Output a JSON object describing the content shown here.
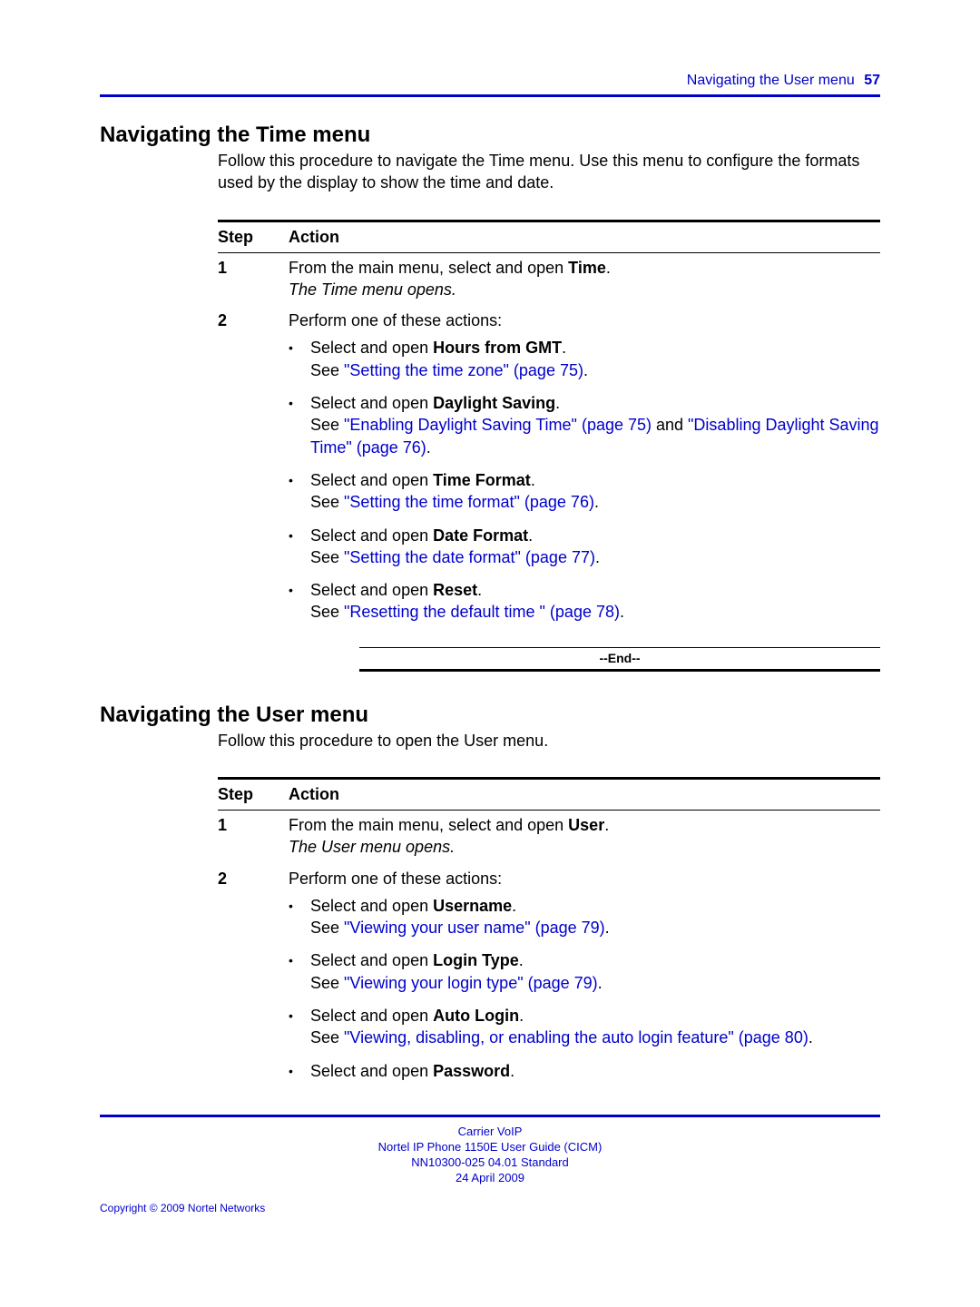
{
  "header": {
    "title": "Navigating the User menu",
    "page": "57"
  },
  "section1": {
    "heading": "Navigating the Time menu",
    "intro": "Follow this procedure to navigate the Time menu. Use this menu to configure the formats used by the display to show the time and date.",
    "step_label": "Step",
    "action_label": "Action",
    "step1_num": "1",
    "step1_a": "From the main menu, select and open ",
    "step1_bold": "Time",
    "step1_b": ".",
    "step1_note": "The Time menu opens.",
    "step2_num": "2",
    "step2_text": "Perform one of these actions:",
    "b1_a": "Select and open ",
    "b1_bold": "Hours from GMT",
    "b1_b": ".",
    "b1_see": "See ",
    "b1_link": "\"Setting the time zone\" (page 75)",
    "b1_end": ".",
    "b2_a": "Select and open ",
    "b2_bold": "Daylight Saving",
    "b2_b": ".",
    "b2_see": "See ",
    "b2_link1": "\"Enabling Daylight Saving Time\" (page 75)",
    "b2_mid": " and ",
    "b2_link2": "\"Disabling Daylight Saving Time\" (page 76)",
    "b2_end": ".",
    "b3_a": "Select and open ",
    "b3_bold": "Time Format",
    "b3_b": ".",
    "b3_see": "See ",
    "b3_link": "\"Setting the time format\" (page 76)",
    "b3_end": ".",
    "b4_a": "Select and open ",
    "b4_bold": "Date Format",
    "b4_b": ".",
    "b4_see": "See ",
    "b4_link": "\"Setting the date format\" (page 77)",
    "b4_end": ".",
    "b5_a": "Select and open ",
    "b5_bold": "Reset",
    "b5_b": ".",
    "b5_see": "See ",
    "b5_link": "\"Resetting the default time \" (page 78)",
    "b5_end": ".",
    "end": "--End--"
  },
  "section2": {
    "heading": "Navigating the User menu",
    "intro": "Follow this procedure to open the User menu.",
    "step_label": "Step",
    "action_label": "Action",
    "step1_num": "1",
    "step1_a": "From the main menu, select and open ",
    "step1_bold": "User",
    "step1_b": ".",
    "step1_note": "The User menu opens.",
    "step2_num": "2",
    "step2_text": "Perform one of these actions:",
    "b1_a": "Select and open ",
    "b1_bold": "Username",
    "b1_b": ".",
    "b1_see": "See ",
    "b1_link": "\"Viewing your user name\" (page 79)",
    "b1_end": ".",
    "b2_a": "Select and open ",
    "b2_bold": "Login Type",
    "b2_b": ".",
    "b2_see": "See ",
    "b2_link": "\"Viewing your login type\" (page 79)",
    "b2_end": ".",
    "b3_a": "Select and open ",
    "b3_bold": "Auto Login",
    "b3_b": ".",
    "b3_see": "See ",
    "b3_link": "\"Viewing, disabling, or enabling the auto login feature\" (page 80)",
    "b3_end": ".",
    "b4_a": "Select and open ",
    "b4_bold": "Password",
    "b4_b": "."
  },
  "footer": {
    "l1": "Carrier VoIP",
    "l2": "Nortel IP Phone 1150E User Guide (CICM)",
    "l3": "NN10300-025   04.01   Standard",
    "l4": "24 April 2009",
    "copyright": "Copyright © 2009 Nortel Networks"
  }
}
